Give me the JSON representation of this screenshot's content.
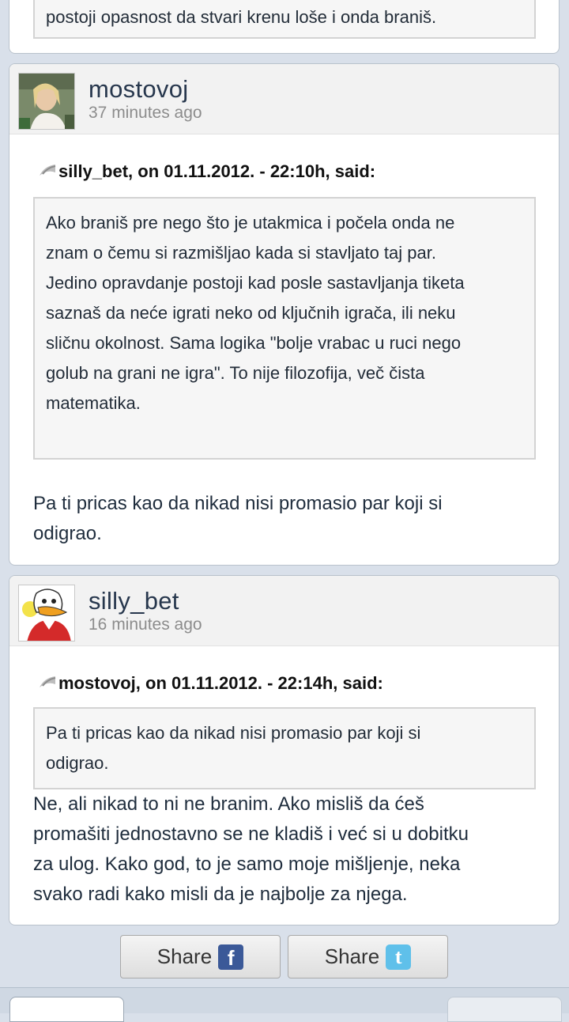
{
  "top_partial": {
    "quote_tail": "postoji opasnost da stvari krenu loše i onda braniš."
  },
  "posts": [
    {
      "author": "mostovoj",
      "time": "37 minutes ago",
      "citation": "silly_bet, on 01.11.2012. - 22:10h, said:",
      "quote_lines": [
        "Ako braniš pre nego što je utakmica i počela onda ne",
        "znam o čemu si razmišljao kada si stavljato taj par.",
        "Jedino opravdanje postoji kad posle sastavljanja tiketa",
        "saznaš da neće igrati neko od ključnih igrača, ili neku",
        "sličnu okolnost. Sama logika \"bolje vrabac u ruci nego",
        "golub na grani ne igra\". To nije filozofija, več čista",
        "matematika."
      ],
      "body_lines": [
        "Pa ti pricas kao da nikad nisi promasio par koji si",
        "odigrao."
      ]
    },
    {
      "author": "silly_bet",
      "time": "16 minutes ago",
      "citation": "mostovoj, on 01.11.2012. - 22:14h, said:",
      "quote_lines": [
        "Pa ti pricas kao da nikad nisi promasio par koji si",
        "odigrao."
      ],
      "body_lines": [
        "Ne, ali nikad to ni ne branim. Ako misliš da ćeš",
        "promašiti jednostavno se ne kladiš i već si u dobitku",
        "za ulog. Kako god, to je samo moje mišljenje, neka",
        "svako radi kako misli da je najbolje za njega."
      ]
    }
  ],
  "share": {
    "facebook_label": "Share",
    "facebook_icon": "facebook-icon",
    "twitter_label": "Share",
    "twitter_icon": "twitter-icon"
  }
}
